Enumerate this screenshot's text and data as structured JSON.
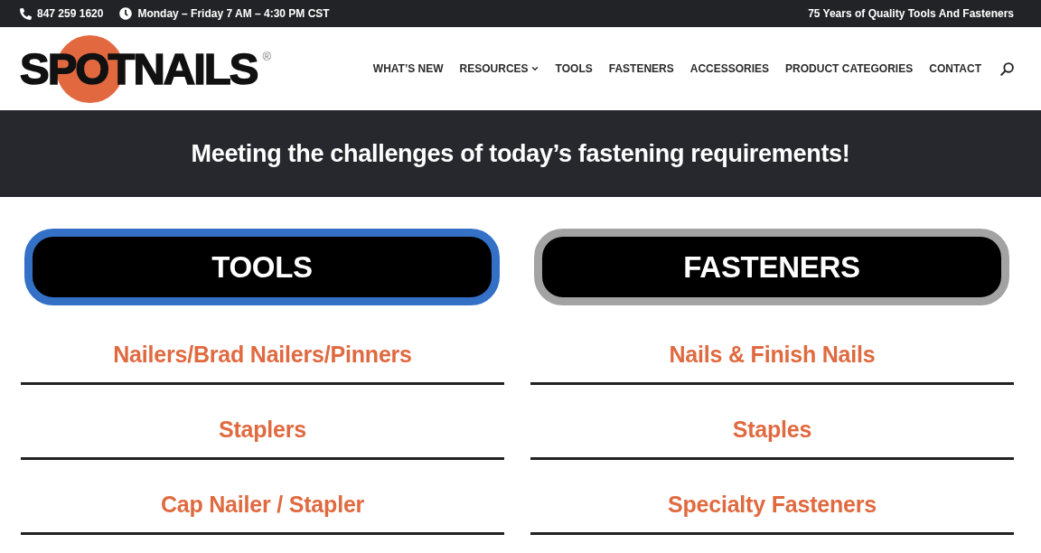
{
  "top_bar": {
    "phone": "847 259 1620",
    "hours": "Monday – Friday 7 AM – 4:30 PM CST",
    "tagline": "75 Years of Quality Tools And Fasteners"
  },
  "header": {
    "logo": "SPOTNAILS$^{®}$",
    "nav": [
      {
        "label": "WHAT’S NEW",
        "has_dropdown": false
      },
      {
        "label": "RESOURCES",
        "has_dropdown": true
      },
      {
        "label": "TOOLS",
        "has_dropdown": false
      },
      {
        "label": "FASTENERS",
        "has_dropdown": false
      },
      {
        "label": "ACCESSORIES",
        "has_dropdown": false
      },
      {
        "label": "PRODUCT CATEGORIES",
        "has_dropdown": false
      },
      {
        "label": "CONTACT",
        "has_dropdown": false
      }
    ]
  },
  "banner": {
    "heading": "Meeting the challenges of today’s fastening requirements!"
  },
  "columns": [
    {
      "title": "TOOLS",
      "selected": true,
      "links": [
        "Nailers/Brad Nailers/Pinners",
        "Staplers",
        "Cap Nailer / Stapler"
      ]
    },
    {
      "title": "FASTENERS",
      "selected": false,
      "links": [
        "Nails & Finish Nails",
        "Staples",
        "Specialty Fasteners"
      ]
    }
  ]
}
